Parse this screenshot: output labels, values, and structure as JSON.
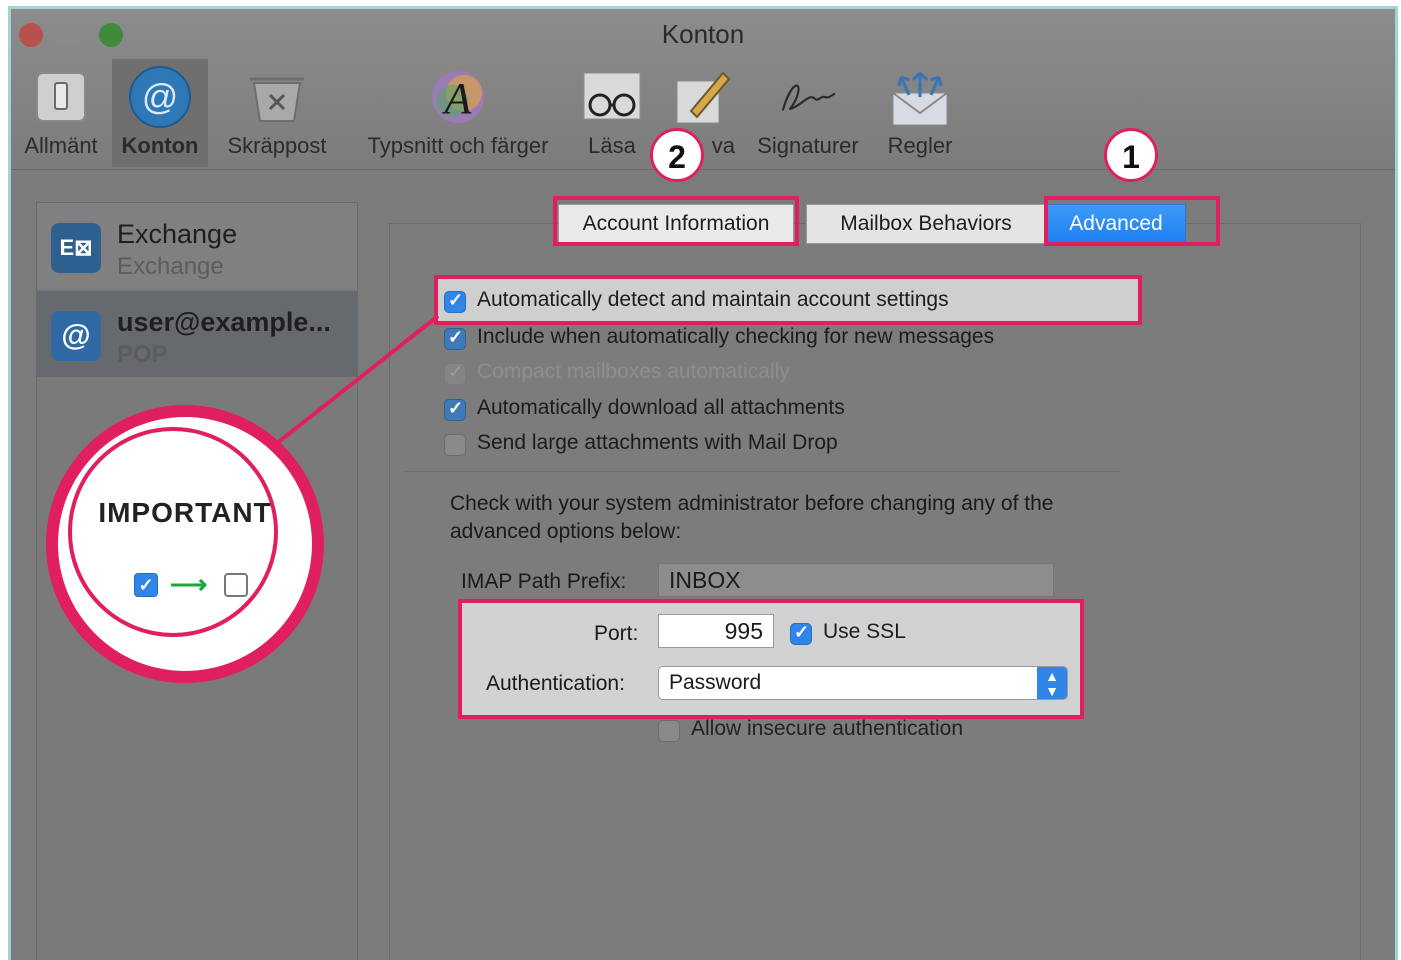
{
  "window": {
    "title": "Konton"
  },
  "toolbar": {
    "items": [
      {
        "label": "Allmänt",
        "icon": "switch-icon"
      },
      {
        "label": "Konton",
        "icon": "at-sign-icon"
      },
      {
        "label": "Skräppost",
        "icon": "junk-trash-icon"
      },
      {
        "label": "Typsnitt och färger",
        "icon": "font-colors-icon"
      },
      {
        "label": "Läsa",
        "icon": "glasses-icon"
      },
      {
        "label": "va",
        "icon": "pencil-icon"
      },
      {
        "label": "Signaturer",
        "icon": "signature-icon"
      },
      {
        "label": "Regler",
        "icon": "rules-envelope-icon"
      }
    ]
  },
  "accounts": [
    {
      "name": "Exchange",
      "type": "Exchange",
      "icon": "exchange-icon"
    },
    {
      "name": "user@example...",
      "type": "POP",
      "icon": "at-sign-icon"
    }
  ],
  "tabs": [
    {
      "label": "Account Information"
    },
    {
      "label": "Mailbox Behaviors"
    },
    {
      "label": "Advanced"
    }
  ],
  "options": [
    {
      "label": "Automatically detect and maintain account settings",
      "checked": true
    },
    {
      "label": "Include when automatically checking for new messages",
      "checked": true
    },
    {
      "label": "Compact mailboxes automatically",
      "checked": true,
      "disabled": true
    },
    {
      "label": "Automatically download all attachments",
      "checked": true
    },
    {
      "label": "Send large attachments with Mail Drop",
      "checked": false
    }
  ],
  "note": "Check with your system administrator before changing any of the advanced options below:",
  "imap": {
    "label": "IMAP Path Prefix:",
    "value": "INBOX"
  },
  "port": {
    "label": "Port:",
    "value": "995"
  },
  "ssl": {
    "label": "Use SSL",
    "checked": true
  },
  "auth": {
    "label": "Authentication:",
    "value": "Password"
  },
  "insecure": {
    "label": "Allow insecure authentication",
    "checked": false
  },
  "annotations": {
    "badge1": "1",
    "badge2": "2",
    "important": "IMPORTANT",
    "highlight_color": "#e0205e"
  }
}
